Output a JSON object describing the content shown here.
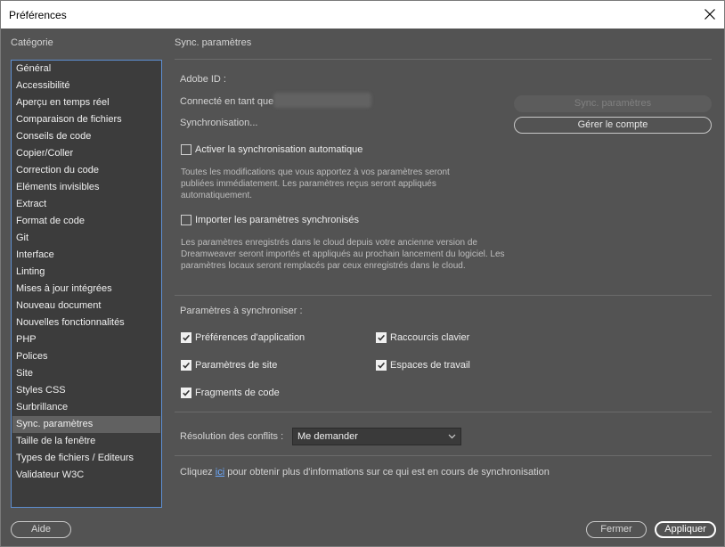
{
  "window": {
    "title": "Préférences",
    "close_icon": "close-icon"
  },
  "sidebar": {
    "header": "Catégorie",
    "selected_index": 21,
    "items": [
      {
        "label": "Général"
      },
      {
        "label": "Accessibilité"
      },
      {
        "label": "Aperçu en temps réel"
      },
      {
        "label": "Comparaison de fichiers"
      },
      {
        "label": "Conseils de code"
      },
      {
        "label": "Copier/Coller"
      },
      {
        "label": "Correction du code"
      },
      {
        "label": "Eléments invisibles"
      },
      {
        "label": "Extract"
      },
      {
        "label": "Format de code"
      },
      {
        "label": "Git"
      },
      {
        "label": "Interface"
      },
      {
        "label": "Linting"
      },
      {
        "label": "Mises à jour intégrées"
      },
      {
        "label": "Nouveau document"
      },
      {
        "label": "Nouvelles fonctionnalités"
      },
      {
        "label": "PHP"
      },
      {
        "label": "Polices"
      },
      {
        "label": "Site"
      },
      {
        "label": "Styles CSS"
      },
      {
        "label": "Surbrillance"
      },
      {
        "label": "Sync. paramètres"
      },
      {
        "label": "Taille de la fenêtre"
      },
      {
        "label": "Types de fichiers / Editeurs"
      },
      {
        "label": "Validateur W3C"
      }
    ]
  },
  "panel": {
    "title": "Sync. paramètres",
    "adobe_id_label": "Adobe ID :",
    "connected_label": "Connecté en tant que",
    "sync_button": "Sync. paramètres",
    "syncing_status": "Synchronisation...",
    "manage_account_button": "Gérer le compte",
    "auto_sync": {
      "label": "Activer la synchronisation automatique",
      "checked": false,
      "description": "Toutes les modifications que vous apportez à vos paramètres seront publiées immédiatement. Les paramètres reçus seront appliqués automatiquement."
    },
    "import_sync": {
      "label": "Importer les paramètres synchronisés",
      "checked": false,
      "description": "Les paramètres enregistrés dans le cloud depuis votre ancienne version de Dreamweaver seront importés et appliqués au prochain lancement du logiciel. Les paramètres locaux seront remplacés par ceux enregistrés dans le cloud."
    },
    "sync_section_label": "Paramètres à synchroniser :",
    "sync_options": {
      "app_prefs": {
        "label": "Préférences d'application",
        "checked": true
      },
      "shortcuts": {
        "label": "Raccourcis clavier",
        "checked": true
      },
      "site_params": {
        "label": "Paramètres de site",
        "checked": true
      },
      "workspaces": {
        "label": "Espaces de travail",
        "checked": true
      },
      "code_snippets": {
        "label": "Fragments de code",
        "checked": true
      }
    },
    "conflict_label": "Résolution des conflits :",
    "conflict_value": "Me demander",
    "info_prefix": "Cliquez ",
    "info_link": "ici",
    "info_suffix": " pour obtenir plus d'informations sur ce qui est en cours de synchronisation"
  },
  "footer": {
    "help_button": "Aide",
    "close_button": "Fermer",
    "apply_button": "Appliquer"
  },
  "colors": {
    "background": "#535353",
    "list_background": "#3c3c3c",
    "selection": "#616161",
    "focus_border": "#5e8fd2",
    "link": "#6aa9ff"
  }
}
